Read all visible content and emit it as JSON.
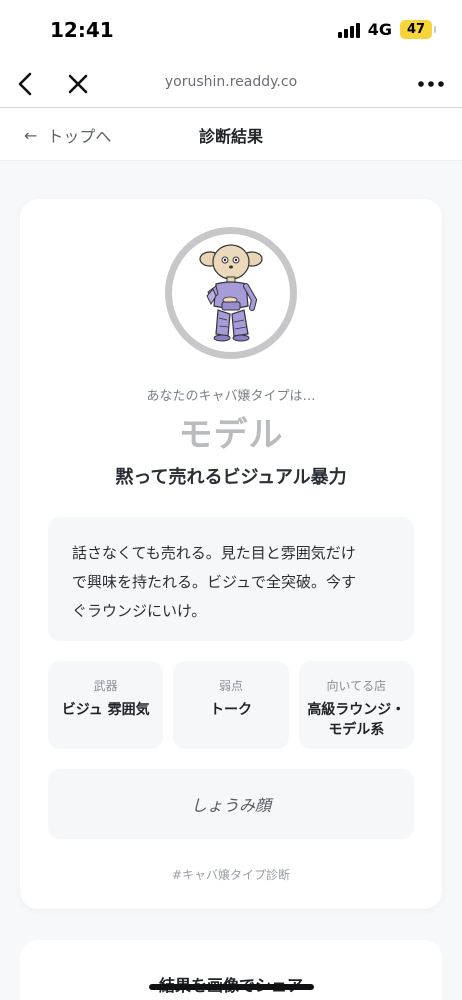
{
  "status_bar": {
    "time": "12:41",
    "network": "4G",
    "battery": "47"
  },
  "browser": {
    "url": "yorushin.readdy.co"
  },
  "header": {
    "back_label": "トップへ",
    "title": "診断結果"
  },
  "result": {
    "intro": "あなたのキャバ嬢タイプは…",
    "type_name": "モデル",
    "tagline": "黙って売れるビジュアル暴力",
    "description_lines": [
      "話さなくても売れる。見た目と雰囲気だけ",
      "で興味を持たれる。ビジュで全突破。今す",
      "ぐラウンジにいけ。"
    ],
    "stats": [
      {
        "label": "武器",
        "value": "ビジュ 雰囲気"
      },
      {
        "label": "弱点",
        "value": "トーク"
      },
      {
        "label": "向いてる店",
        "value": "高級ラウンジ・モデル系"
      }
    ],
    "face": "しょうみ顔",
    "hashtag": "#キャバ嬢タイプ診断"
  },
  "share": {
    "title": "結果を画像でシェア"
  },
  "icons": {
    "back": "chevron-left-icon",
    "close": "close-icon",
    "more": "more-horizontal-icon",
    "arrow": "arrow-left-icon",
    "avatar": "character-illustration"
  },
  "colors": {
    "background": "#f7f8fa",
    "card": "#ffffff",
    "muted_box": "#f6f7f9",
    "type_name": "#b9bbbf",
    "battery": "#f7d43a",
    "outfit_purple": "#a79bd9"
  }
}
